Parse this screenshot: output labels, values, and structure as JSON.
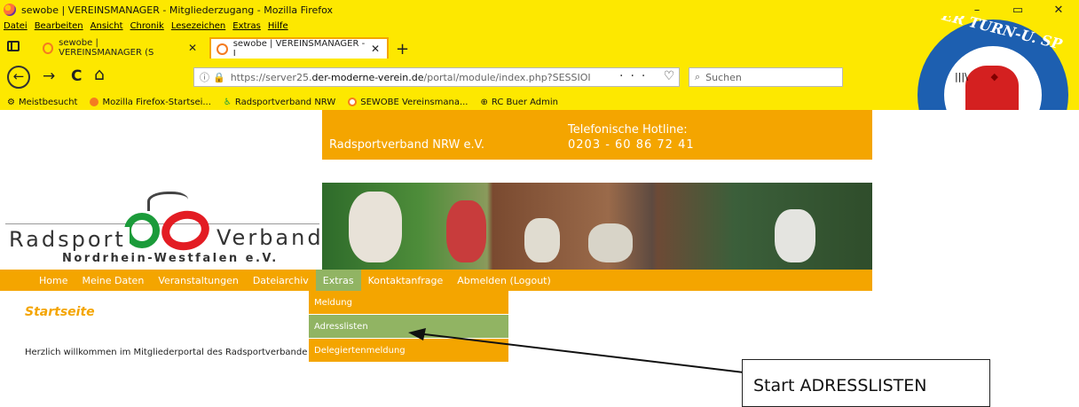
{
  "window": {
    "title": "sewobe | VEREINSMANAGER - Mitgliederzugang - Mozilla Firefox",
    "minimize": "–",
    "maximize": "▭",
    "close": "✕"
  },
  "menu": [
    "Datei",
    "Bearbeiten",
    "Ansicht",
    "Chronik",
    "Lesezeichen",
    "Extras",
    "Hilfe"
  ],
  "tabs": [
    {
      "label": "sewobe | VEREINSMANAGER (S",
      "close": "✕"
    },
    {
      "label": "sewobe | VEREINSMANAGER - I",
      "close": "✕"
    }
  ],
  "newtab": "+",
  "nav": {
    "back": "←",
    "forward": "→",
    "reload": "C",
    "home": "⌂",
    "url_prefix": "https://server25.",
    "url_domain": "der-moderne-verein.de",
    "url_path": "/portal/module/index.php?SESSIOI",
    "url_actions": "··· ♡ ☆",
    "search_placeholder": "Suchen",
    "search_icon": "magnifier-icon"
  },
  "bookmarks": [
    {
      "label": "Meistbesucht"
    },
    {
      "label": "Mozilla Firefox-Startsei..."
    },
    {
      "label": "Radsportverband NRW"
    },
    {
      "label": "SEWOBE Vereinsmana..."
    },
    {
      "label": "RC Buer Admin"
    }
  ],
  "emblem": {
    "text": "ER TURN-U. SP"
  },
  "header": {
    "org": "Radsportverband NRW e.V.",
    "hotline_title": "Telefonische Hotline:",
    "hotline_number": "0203 - 60 86 72 41"
  },
  "logo": {
    "word1": "Radsport",
    "word2": "Verband",
    "sub": "Nordrhein-Westfalen e.V."
  },
  "mainnav": [
    "Home",
    "Meine Daten",
    "Veranstaltungen",
    "Dateiarchiv",
    "Extras",
    "Kontaktanfrage",
    "Abmelden (Logout)"
  ],
  "dropdown": [
    "Meldung",
    "Adresslisten",
    "Delegiertenmeldung"
  ],
  "content": {
    "title": "Startseite",
    "welcome": "Herzlich willkommen im Mitgliederportal des Radsportverbande"
  },
  "annotation": {
    "label": "Start ADRESSLISTEN"
  },
  "colors": {
    "accent": "#f4a500",
    "active": "#91b463",
    "chrome": "#fde800"
  }
}
